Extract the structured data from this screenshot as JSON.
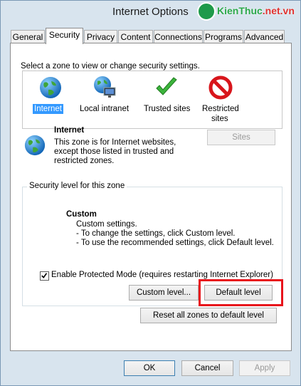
{
  "window": {
    "title": "Internet Options"
  },
  "watermark": {
    "text_main": "KienThuc",
    "text_accent": ".net.vn"
  },
  "tabs": [
    {
      "label": "General"
    },
    {
      "label": "Security"
    },
    {
      "label": "Privacy"
    },
    {
      "label": "Content"
    },
    {
      "label": "Connections"
    },
    {
      "label": "Programs"
    },
    {
      "label": "Advanced"
    }
  ],
  "active_tab": "Security",
  "security": {
    "select_zone_label": "Select a zone to view or change security settings.",
    "zones": [
      {
        "label": "Internet",
        "icon": "globe-icon"
      },
      {
        "label": "Local intranet",
        "icon": "intranet-globe-icon"
      },
      {
        "label": "Trusted sites",
        "icon": "check-icon"
      },
      {
        "label": "Restricted sites",
        "label_line1": "Restricted",
        "label_line2": "sites",
        "icon": "restricted-icon"
      }
    ],
    "selected_zone": "Internet",
    "zone_info": {
      "title": "Internet",
      "line1": "This zone is for Internet websites,",
      "line2": "except those listed in trusted and",
      "line3": "restricted zones."
    },
    "sites_button": "Sites",
    "level_group_label": "Security level for this zone",
    "level": {
      "name": "Custom",
      "line1": "Custom settings.",
      "line2": "- To change the settings, click Custom level.",
      "line3": "- To use the recommended settings, click Default level."
    },
    "protected_mode_label": "Enable Protected Mode (requires restarting Internet Explorer)",
    "protected_mode_checked": true,
    "custom_level_button": "Custom level...",
    "default_level_button": "Default level",
    "reset_all_button": "Reset all zones to default level"
  },
  "dialog_buttons": {
    "ok": "OK",
    "cancel": "Cancel",
    "apply": "Apply"
  },
  "colors": {
    "highlight": "#e8141c",
    "selection": "#3399ff"
  }
}
